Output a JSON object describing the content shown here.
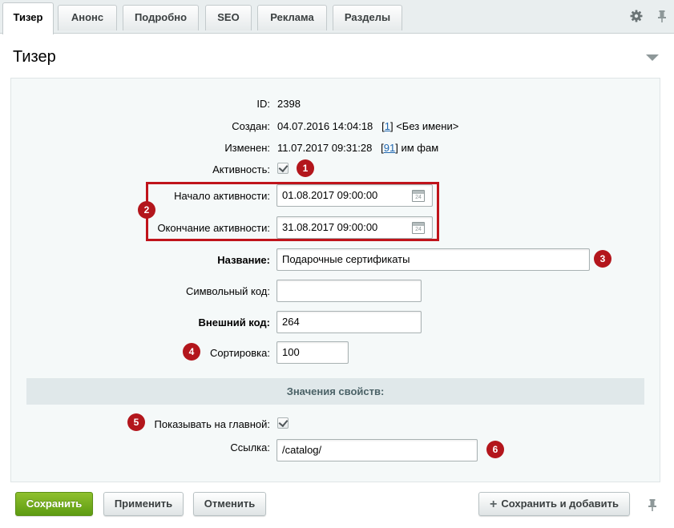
{
  "tabs": [
    {
      "label": "Тизер",
      "active": true
    },
    {
      "label": "Анонс"
    },
    {
      "label": "Подробно"
    },
    {
      "label": "SEO"
    },
    {
      "label": "Реклама"
    },
    {
      "label": "Разделы"
    }
  ],
  "toolbar_icons": [
    "gear-icon",
    "pin-icon"
  ],
  "section_title": "Тизер",
  "fields": {
    "id": {
      "label": "ID:",
      "value": "2398"
    },
    "created": {
      "label": "Создан:",
      "value": "04.07.2016 14:04:18",
      "user_link": "1",
      "user_name": "<Без имени>"
    },
    "modified": {
      "label": "Изменен:",
      "value": "11.07.2017 09:31:28",
      "user_link": "91",
      "user_name": "им фам"
    },
    "active": {
      "label": "Активность:",
      "checked": true
    },
    "active_from": {
      "label": "Начало активности:",
      "value": "01.08.2017 09:00:00"
    },
    "active_to": {
      "label": "Окончание активности:",
      "value": "31.08.2017 09:00:00"
    },
    "name": {
      "label": "Название:",
      "value": "Подарочные  сертификаты"
    },
    "code": {
      "label": "Символьный код:",
      "value": ""
    },
    "xml_id": {
      "label": "Внешний код:",
      "value": "264"
    },
    "sort": {
      "label": "Сортировка:",
      "value": "100"
    }
  },
  "calendar_icon_text": "24",
  "properties_section": "Значения свойств:",
  "properties": {
    "show_main": {
      "label": "Показывать на главной:",
      "checked": true
    },
    "link": {
      "label": "Ссылка:",
      "value": "/catalog/"
    }
  },
  "badges": [
    "1",
    "2",
    "3",
    "4",
    "5",
    "6"
  ],
  "buttons": {
    "save": "Сохранить",
    "apply": "Применить",
    "cancel": "Отменить",
    "save_add": "Сохранить и добавить"
  },
  "colors": {
    "badge": "#b3161c",
    "primary_button": "#6aa81a",
    "link": "#2067b0",
    "highlight": "#c0141b"
  }
}
